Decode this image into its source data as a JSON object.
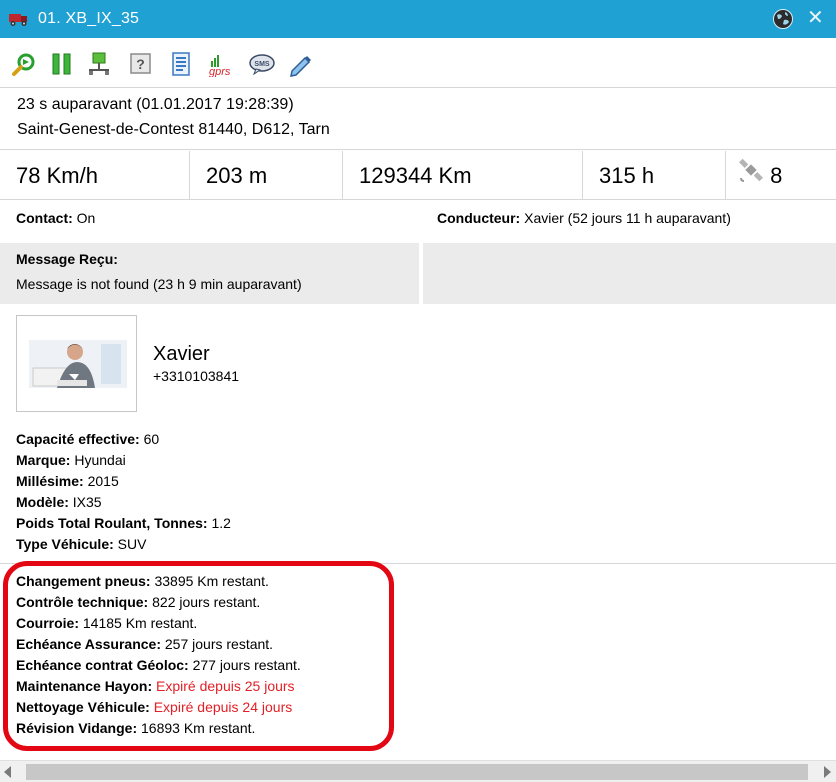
{
  "window": {
    "title": "01. XB_IX_35",
    "close_glyph": "✕"
  },
  "toolbar": {
    "icons": [
      "locate-icon",
      "pause-icon",
      "network-icon",
      "help-icon",
      "report-icon",
      "gprs-icon",
      "sms-icon",
      "edit-icon"
    ],
    "gprs_label": "gprs",
    "sms_label": "SMS",
    "help_label": "?"
  },
  "location": {
    "time": "23 s auparavant (01.01.2017 19:28:39)",
    "address": "Saint-Genest-de-Contest 81440, D612, Tarn"
  },
  "stats": {
    "speed": "78 Km/h",
    "altitude": "203 m",
    "odometer": "129344 Km",
    "engine_hours": "315 h",
    "satellites": "8"
  },
  "status": {
    "contact_label": "Contact:",
    "contact_value": "On",
    "driver_label": "Conducteur:",
    "driver_value": "Xavier (52 jours 11 h auparavant)"
  },
  "message": {
    "title": "Message Reçu:",
    "body": "Message is not found (23 h 9 min auparavant)"
  },
  "driver": {
    "name": "Xavier",
    "phone": "+3310103841"
  },
  "specs": [
    {
      "label": "Capacité effective:",
      "value": "60"
    },
    {
      "label": "Marque:",
      "value": "Hyundai"
    },
    {
      "label": "Millésime:",
      "value": "2015"
    },
    {
      "label": "Modèle:",
      "value": "IX35"
    },
    {
      "label": "Poids Total Roulant, Tonnes:",
      "value": "1.2"
    },
    {
      "label": "Type Véhicule:",
      "value": "SUV"
    }
  ],
  "maintenance": [
    {
      "label": "Changement pneus:",
      "value": "33895 Km restant."
    },
    {
      "label": "Contrôle technique:",
      "value": "822 jours restant."
    },
    {
      "label": "Courroie:",
      "value": "14185 Km restant."
    },
    {
      "label": "Echéance Assurance:",
      "value": "257 jours restant."
    },
    {
      "label": "Echéance contrat Géoloc:",
      "value": "277 jours restant."
    },
    {
      "label": "Maintenance Hayon:",
      "value": "Expiré depuis 25 jours"
    },
    {
      "label": "Nettoyage Véhicule:",
      "value": "Expiré depuis 24 jours"
    },
    {
      "label": "Révision Vidange:",
      "value": "16893 Km restant."
    }
  ],
  "colors": {
    "titlebar": "#1fa1d3",
    "expired": "#e31f26",
    "highlight": "#e30613",
    "panel": "#ebebeb"
  }
}
